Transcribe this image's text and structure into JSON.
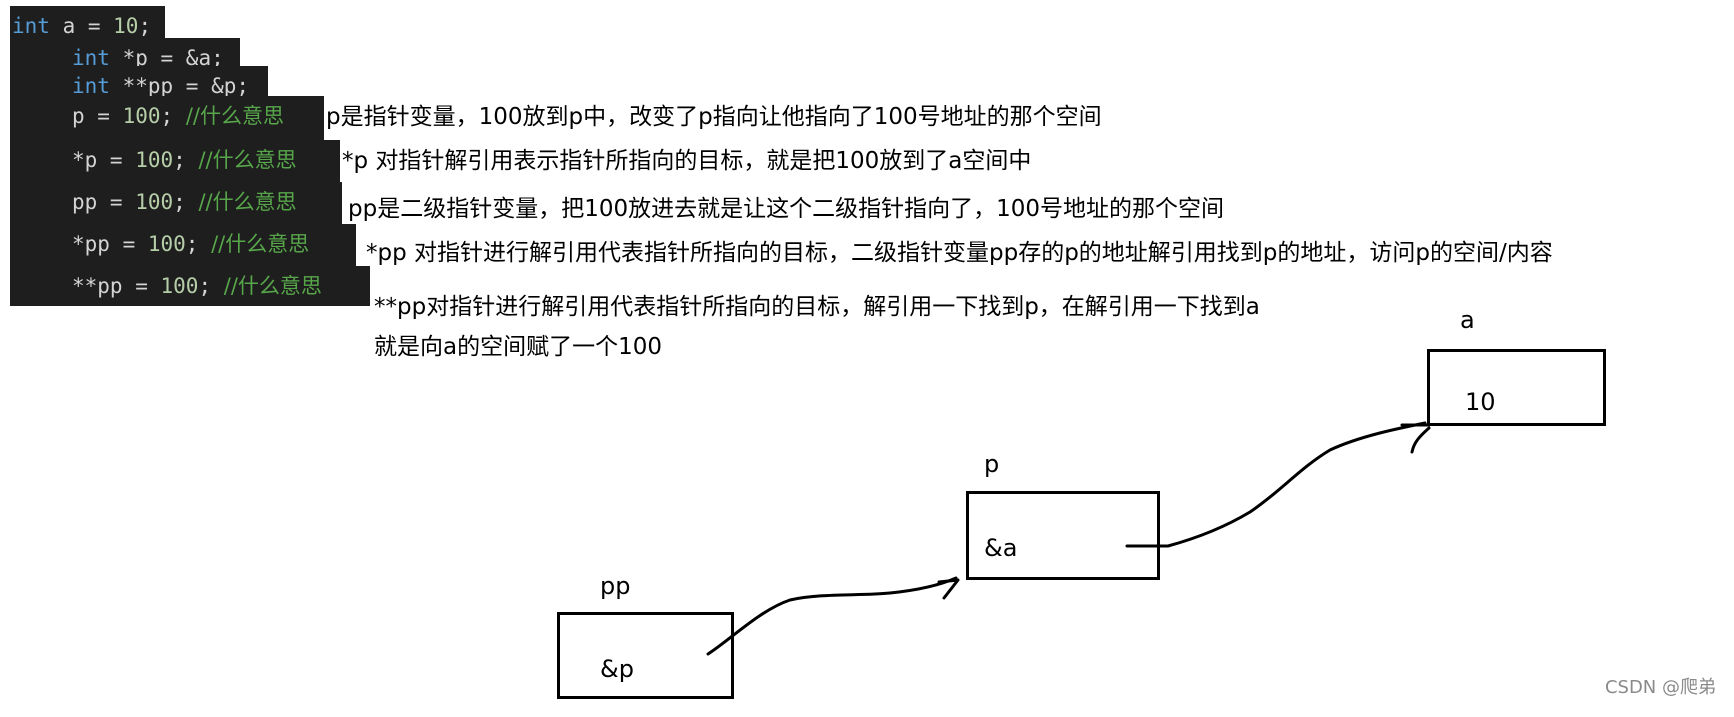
{
  "code": {
    "lines": [
      {
        "kw": "int",
        "rest": " a = ",
        "num": "10",
        "tail": ";",
        "comment": ""
      },
      {
        "kw": "int",
        "rest": " *p = &a;",
        "num": "",
        "tail": "",
        "comment": ""
      },
      {
        "kw": "int",
        "rest": " **pp = &p;",
        "num": "",
        "tail": "",
        "comment": ""
      },
      {
        "kw": "",
        "rest": "p = ",
        "num": "100",
        "tail": "; ",
        "comment": "//什么意思"
      },
      {
        "kw": "",
        "rest": "*p = ",
        "num": "100",
        "tail": "; ",
        "comment": "//什么意思"
      },
      {
        "kw": "",
        "rest": "pp = ",
        "num": "100",
        "tail": "; ",
        "comment": "//什么意思"
      },
      {
        "kw": "",
        "rest": "*pp = ",
        "num": "100",
        "tail": "; ",
        "comment": "//什么意思"
      },
      {
        "kw": "",
        "rest": "**pp = ",
        "num": "100",
        "tail": "; ",
        "comment": "//什么意思"
      }
    ]
  },
  "notes": [
    "p是指针变量，100放到p中，改变了p指向让他指向了100号地址的那个空间",
    "*p 对指针解引用表示指针所指向的目标，就是把100放到了a空间中",
    "pp是二级指针变量，把100放进去就是让这个二级指针指向了，100号地址的那个空间",
    "*pp  对指针进行解引用代表指针所指向的目标，二级指针变量pp存的p的地址解引用找到p的地址，访问p的空间/内容",
    "**pp对指针进行解引用代表指针所指向的目标，解引用一下找到p，在解引用一下找到a",
    "就是向a的空间赋了一个100"
  ],
  "diagram": {
    "boxes": [
      {
        "name": "pp",
        "value": "&p"
      },
      {
        "name": "p",
        "value": "&a"
      },
      {
        "name": "a",
        "value": "10"
      }
    ]
  },
  "watermark": "CSDN @爬弟"
}
